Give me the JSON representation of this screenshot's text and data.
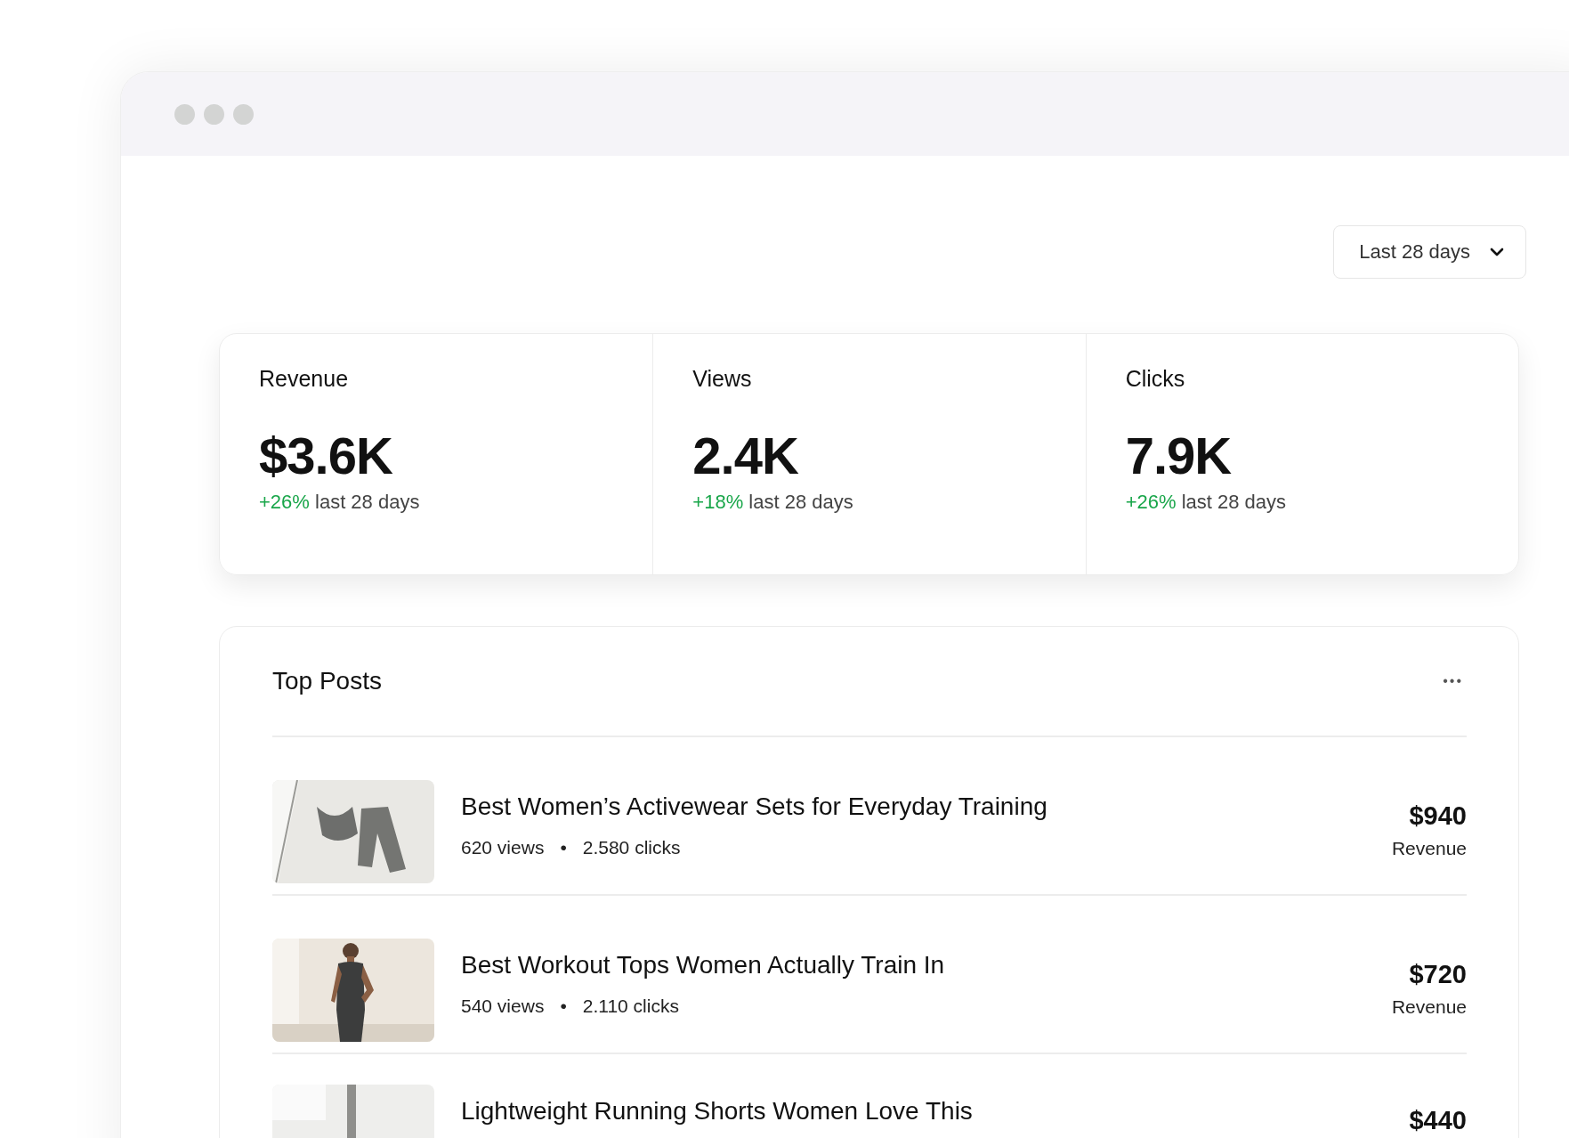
{
  "date_range": {
    "label": "Last 28 days"
  },
  "stats": [
    {
      "label": "Revenue",
      "value": "$3.6K",
      "change": "+26%",
      "period": "last 28 days"
    },
    {
      "label": "Views",
      "value": "2.4K",
      "change": "+18%",
      "period": "last 28 days"
    },
    {
      "label": "Clicks",
      "value": "7.9K",
      "change": "+26%",
      "period": "last 28 days"
    }
  ],
  "top_posts": {
    "title": "Top Posts",
    "more": "•••",
    "posts": [
      {
        "title": "Best Women’s Activewear Sets for Everyday Training",
        "views": "620 views",
        "separator": "•",
        "clicks": "2.580 clicks",
        "revenue": "$940",
        "revenue_label": "Revenue"
      },
      {
        "title": "Best Workout Tops Women Actually Train In",
        "views": "540 views",
        "separator": "•",
        "clicks": "2.110 clicks",
        "revenue": "$720",
        "revenue_label": "Revenue"
      },
      {
        "title": "Lightweight Running Shorts Women Love This",
        "revenue": "$440"
      }
    ]
  }
}
